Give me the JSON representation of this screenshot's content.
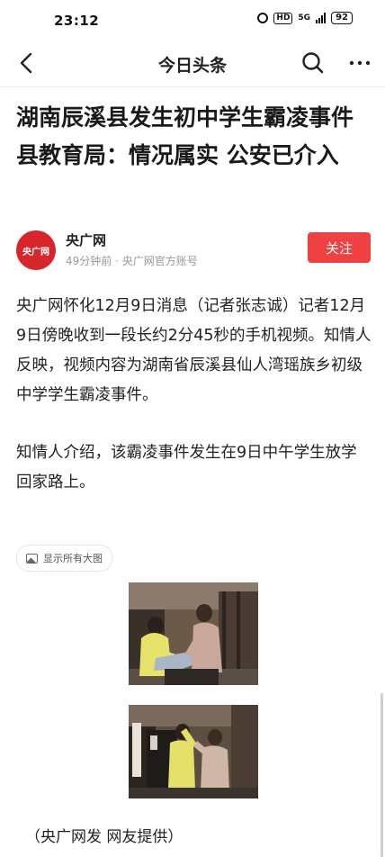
{
  "status_bar": {
    "time": "23:12",
    "alarm_icon": "alarm-clock-icon",
    "hd_label": "HD",
    "network_label": "5G",
    "battery_level": "92"
  },
  "nav": {
    "title": "今日头条",
    "back_icon": "chevron-left-icon",
    "search_icon": "search-icon",
    "more_icon": "more-dots-icon"
  },
  "article": {
    "headline": "湖南辰溪县发生初中学生霸凌事件 县教育局：情况属实 公安已介入",
    "author": {
      "avatar_text": "央广网",
      "name": "央广网",
      "meta": "49分钟前 · 央广网官方账号",
      "follow_label": "关注"
    },
    "paragraphs": [
      "央广网怀化12月9日消息（记者张志诚）记者12月9日傍晚收到一段长约2分45秒的手机视频。知情人反映，视频内容为湖南省辰溪县仙人湾瑶族乡初级中学学生霸凌事件。",
      "知情人介绍，该霸凌事件发生在9日中午学生放学回家路上。"
    ],
    "show_all_images_label": "显示所有大图",
    "caption": "（央广网发 网友提供）"
  },
  "colors": {
    "accent_red": "#f04142",
    "brand_red": "#d6262b",
    "meta_gray": "#999999"
  }
}
